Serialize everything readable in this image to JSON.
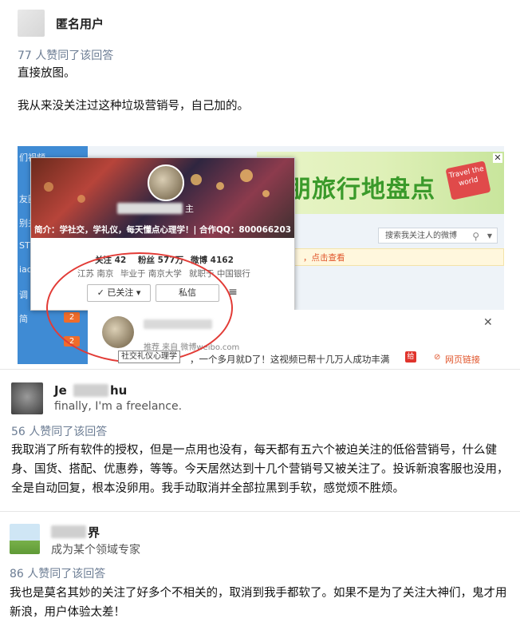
{
  "answers": [
    {
      "user": "匿名用户",
      "votes": "77 人赞同了该回答",
      "lines": [
        "直接放图。",
        "我从来没关注过这种垃圾营销号，自己加的。"
      ]
    },
    {
      "user_prefix": "Je",
      "user_suffix": "hu",
      "bio": "finally, I'm a freelance.",
      "votes": "56 人赞同了该回答",
      "lines": [
        "我取消了所有软件的授权，但是一点用也没有，每天都有五六个被迫关注的低俗营销号，什么健",
        "身、国货、搭配、优惠券，等等。今天居然达到十几个营销号又被关注了。投诉新浪客服也没用，",
        "全是自动回复，根本没卵用。我手动取消并全部拉黑到手软，感觉烦不胜烦。"
      ]
    },
    {
      "user_suffix": "界",
      "bio": "成为某个领域专家",
      "votes": "86 人赞同了该回答",
      "lines": [
        "我也是莫名其妙的关注了好多个不相关的，取消到我手都软了。如果不是为了关注大神们，鬼才用",
        "新浪，用户体验太差！"
      ]
    }
  ],
  "screenshot": {
    "sidebar_items": [
      "们视频",
      "友圈",
      "别关",
      "ST",
      "iao",
      "调",
      "简"
    ],
    "sidebar_badges": [
      "2",
      "2"
    ],
    "banner_text": "朋旅行地盘点",
    "banner_tag": "Travel the world",
    "banner_close": "✕",
    "search_placeholder": "搜索我关注人的微博",
    "notice": "，点击查看",
    "popup": {
      "name_suffix": "主",
      "intro": "简介：学社交，学礼仪，每天懂点心理学！| 合作QQ：800066203",
      "follows": "关注 42",
      "fans": "粉丝 577万",
      "weibo": "微博 4162",
      "location": "江苏 南京",
      "school": "毕业于 南京大学",
      "job": "就职于 中国银行",
      "followed_btn": "✓ 已关注 ▾",
      "message_btn": "私信",
      "menu_icon": "≡"
    },
    "feed": {
      "source": "推荐 来自 微博weibo.com",
      "tooltip": "社交礼仪心理学",
      "text": "，一个多月就D了！这视频已帮十几万人成功丰满",
      "gift_badge": "给",
      "link": "网页链接",
      "close": "✕"
    }
  }
}
